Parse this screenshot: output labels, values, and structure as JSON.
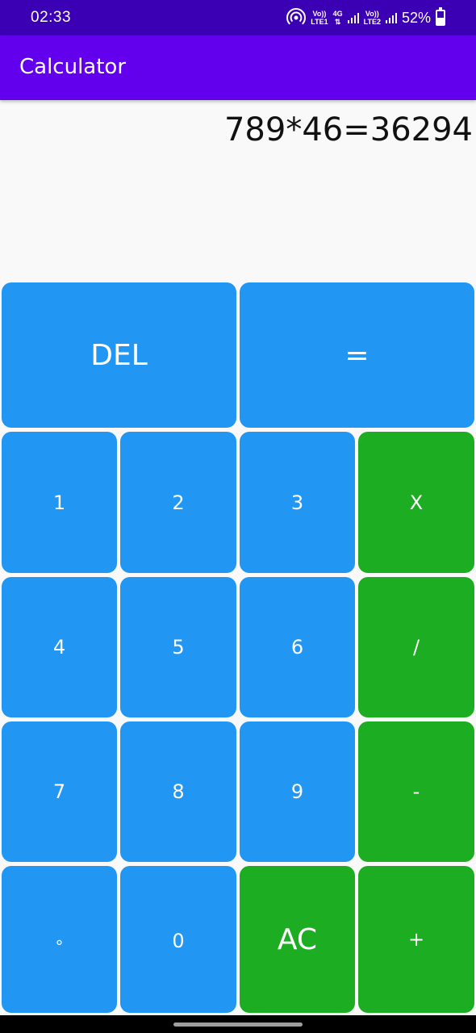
{
  "status_bar": {
    "time": "02:33",
    "net1_top": "Vo))",
    "net1_bottom": "LTE1",
    "net_type": "4G",
    "net2_top": "Vo))",
    "net2_bottom": "LTE2",
    "battery": "52%"
  },
  "app_bar": {
    "title": "Calculator"
  },
  "display": {
    "expression": "789*46=36294"
  },
  "keys": {
    "del": "DEL",
    "equals": "=",
    "one": "1",
    "two": "2",
    "three": "3",
    "multiply": "X",
    "four": "4",
    "five": "5",
    "six": "6",
    "divide": "/",
    "seven": "7",
    "eight": "8",
    "nine": "9",
    "minus": "-",
    "dot": "°",
    "zero": "0",
    "clear": "AC",
    "plus": "+"
  },
  "colors": {
    "status_bar": "#3b00b3",
    "app_bar": "#6200ee",
    "number_key": "#2196f3",
    "operator_key": "#1dad22"
  }
}
